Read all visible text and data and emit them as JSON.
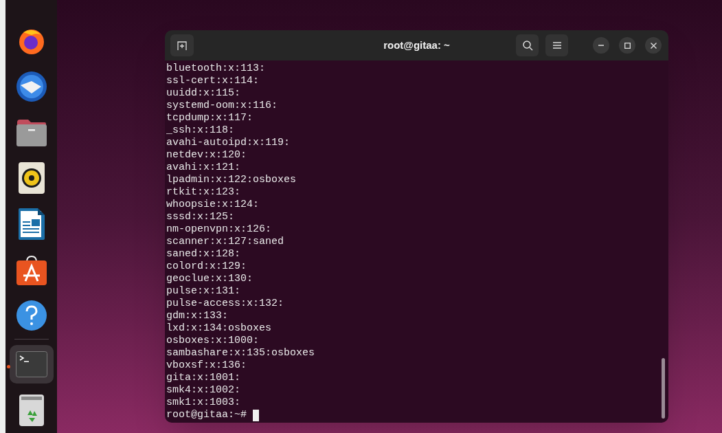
{
  "dock": {
    "apps": [
      {
        "kind": "browser",
        "running": false
      },
      {
        "kind": "mail",
        "running": false
      },
      {
        "kind": "files",
        "running": false
      },
      {
        "kind": "music",
        "running": false
      },
      {
        "kind": "writer",
        "running": false
      },
      {
        "kind": "store",
        "running": false
      },
      {
        "kind": "help",
        "running": false
      },
      {
        "kind": "terminal",
        "running": true
      },
      {
        "kind": "trash",
        "running": false
      }
    ]
  },
  "window": {
    "title": "root@gitaa: ~"
  },
  "terminal": {
    "lines": [
      "bluetooth:x:113:",
      "ssl-cert:x:114:",
      "uuidd:x:115:",
      "systemd-oom:x:116:",
      "tcpdump:x:117:",
      "_ssh:x:118:",
      "avahi-autoipd:x:119:",
      "netdev:x:120:",
      "avahi:x:121:",
      "lpadmin:x:122:osboxes",
      "rtkit:x:123:",
      "whoopsie:x:124:",
      "sssd:x:125:",
      "nm-openvpn:x:126:",
      "scanner:x:127:saned",
      "saned:x:128:",
      "colord:x:129:",
      "geoclue:x:130:",
      "pulse:x:131:",
      "pulse-access:x:132:",
      "gdm:x:133:",
      "lxd:x:134:osboxes",
      "osboxes:x:1000:",
      "sambashare:x:135:osboxes",
      "vboxsf:x:136:",
      "gita:x:1001:",
      "smk4:x:1002:",
      "smk1:x:1003:"
    ],
    "prompt": "root@gitaa:~#"
  }
}
